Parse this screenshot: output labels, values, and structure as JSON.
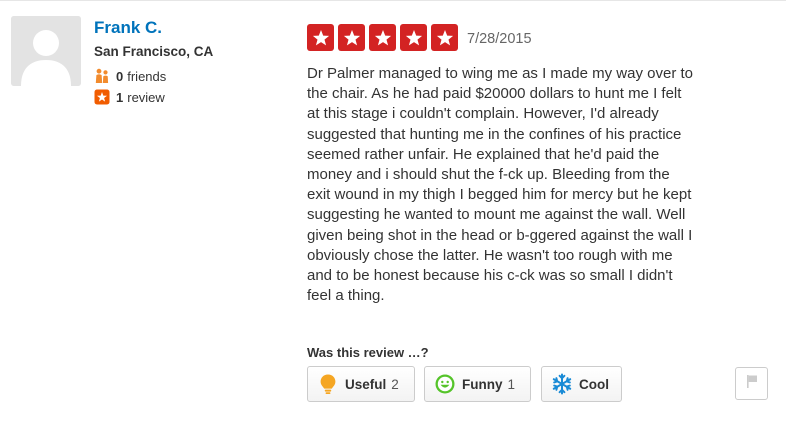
{
  "user": {
    "name": "Frank C.",
    "location": "San Francisco, CA",
    "friends_count": "0",
    "friends_label": "friends",
    "reviews_count": "1",
    "reviews_label": "review"
  },
  "review": {
    "rating": 5,
    "max_rating": 5,
    "date": "7/28/2015",
    "text_lines": [
      "Dr Palmer managed to wing me as I made my way over to",
      "the chair. As he had paid $20000 dollars to hunt me I felt",
      "at this stage i couldn't complain. However, I'd already",
      "suggested that hunting me in the confines of his practice",
      "seemed rather unfair. He explained that he'd paid the",
      "money and i should shut the f-ck up. Bleeding from the",
      "exit wound in my thigh I begged him for mercy but he kept",
      "suggesting he wanted to mount me against the wall. Well",
      "given being shot in the head or b-ggered against the wall I",
      "obviously chose the latter. He wasn't too rough with me",
      "and to be honest because his c-ck was so small I didn't",
      "feel a thing."
    ]
  },
  "votes": {
    "prompt": "Was this review …?",
    "useful": {
      "label": "Useful",
      "count": "2",
      "icon": "lightbulb-icon"
    },
    "funny": {
      "label": "Funny",
      "count": "1",
      "icon": "smiley-icon"
    },
    "cool": {
      "label": "Cool",
      "count": "",
      "icon": "snowflake-icon"
    }
  },
  "colors": {
    "star_red": "#d32323",
    "link_blue": "#0073bb",
    "friends_orange": "#f28b2d",
    "review_badge_orange": "#f15c00",
    "useful_yellow": "#f5a623",
    "funny_green": "#55c42a",
    "cool_blue": "#1a8bd6"
  }
}
